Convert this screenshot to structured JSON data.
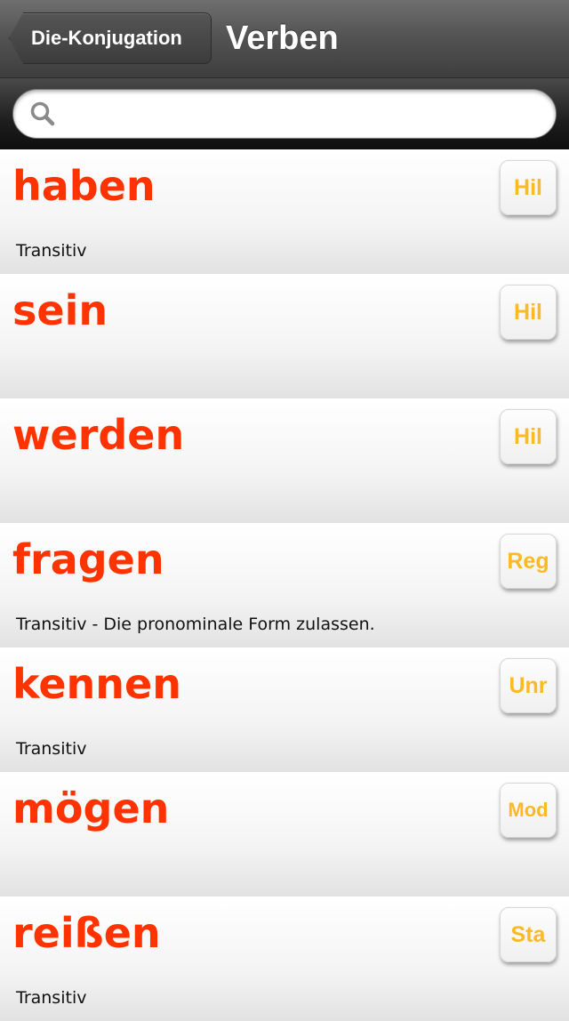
{
  "navbar": {
    "back_label": "Die-Konjugation",
    "title": "Verben"
  },
  "search": {
    "placeholder": "",
    "value": "",
    "icon": "search-icon"
  },
  "colors": {
    "verb": "#ff3300",
    "badge_text": "#fbb924"
  },
  "verbs": [
    {
      "verb": "haben",
      "desc": "Transitiv",
      "badge": "Hil"
    },
    {
      "verb": "sein",
      "desc": "",
      "badge": "Hil"
    },
    {
      "verb": "werden",
      "desc": "",
      "badge": "Hil"
    },
    {
      "verb": "fragen",
      "desc": "Transitiv - Die pronominale Form zulassen.",
      "badge": "Reg"
    },
    {
      "verb": "kennen",
      "desc": "Transitiv",
      "badge": "Unr"
    },
    {
      "verb": "mögen",
      "desc": "",
      "badge": "Mod"
    },
    {
      "verb": "reißen",
      "desc": "Transitiv",
      "badge": "Sta"
    }
  ]
}
